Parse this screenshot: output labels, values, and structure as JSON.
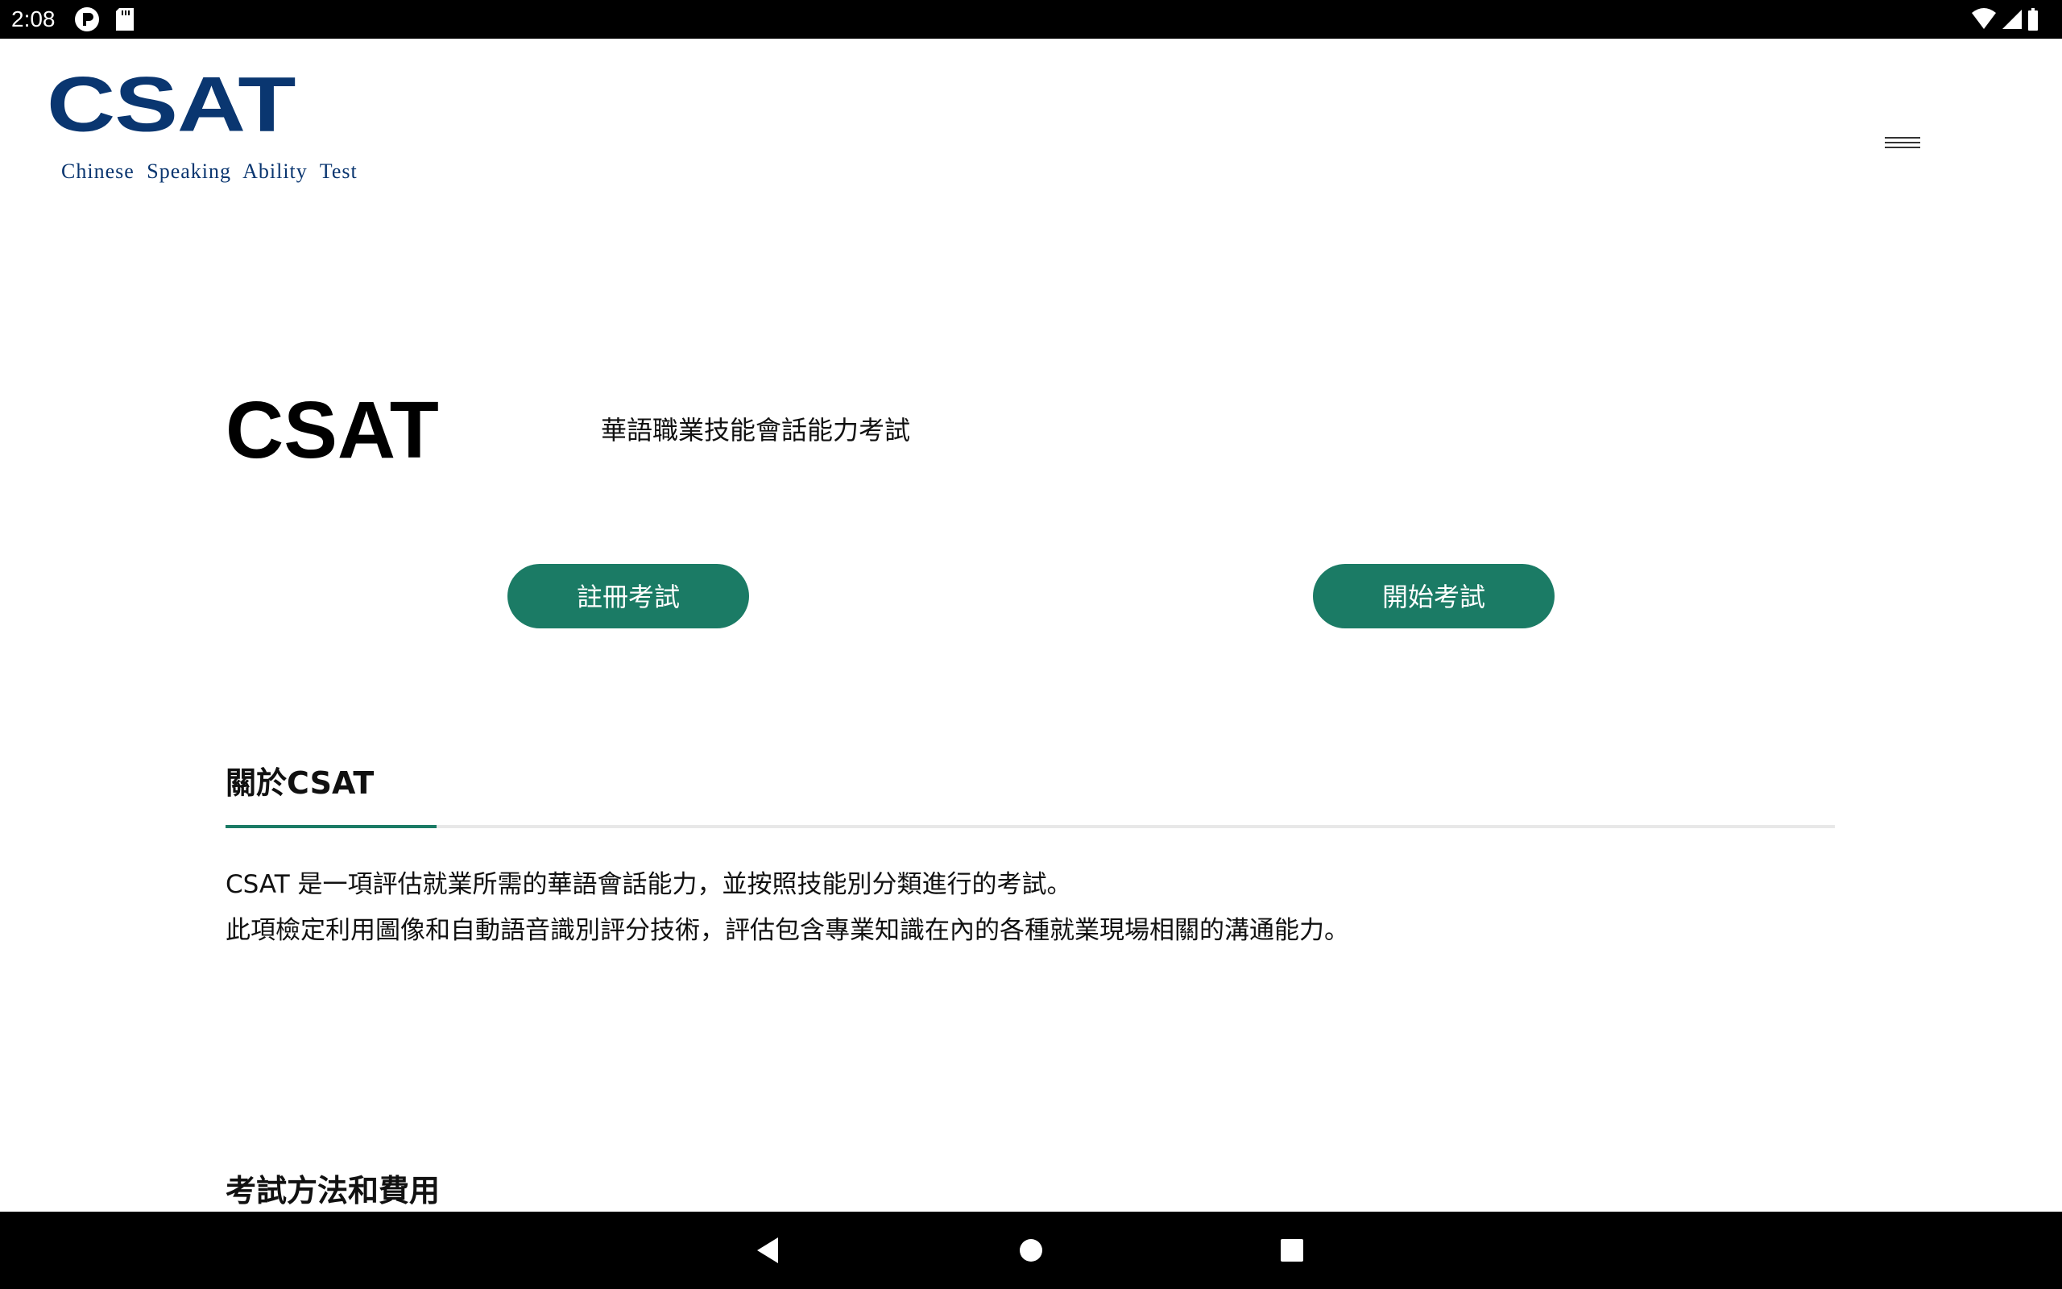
{
  "status_bar": {
    "time": "2:08"
  },
  "header": {
    "logo": {
      "word": "CSAT",
      "tagline": "Chinese  Speaking  Ability  Test",
      "color": "#0a3670"
    },
    "menu_icon": "hamburger-menu-icon"
  },
  "hero": {
    "title": "CSAT",
    "subtitle": "華語職業技能會話能力考試",
    "register_label": "註冊考試",
    "start_label": "開始考試",
    "button_color": "#1b7b65"
  },
  "about": {
    "title": "關於CSAT",
    "paragraphs": [
      "CSAT 是一項評估就業所需的華語會話能力，並按照技能別分類進行的考試。",
      "此項檢定利用圖像和自動語音識別評分技術，評估包含專業知識在內的各種就業現場相關的溝通能力。"
    ]
  },
  "method": {
    "title": "考試方法和費用"
  },
  "nav_bar": {
    "icons": [
      "back-icon",
      "home-icon",
      "recents-icon"
    ]
  }
}
